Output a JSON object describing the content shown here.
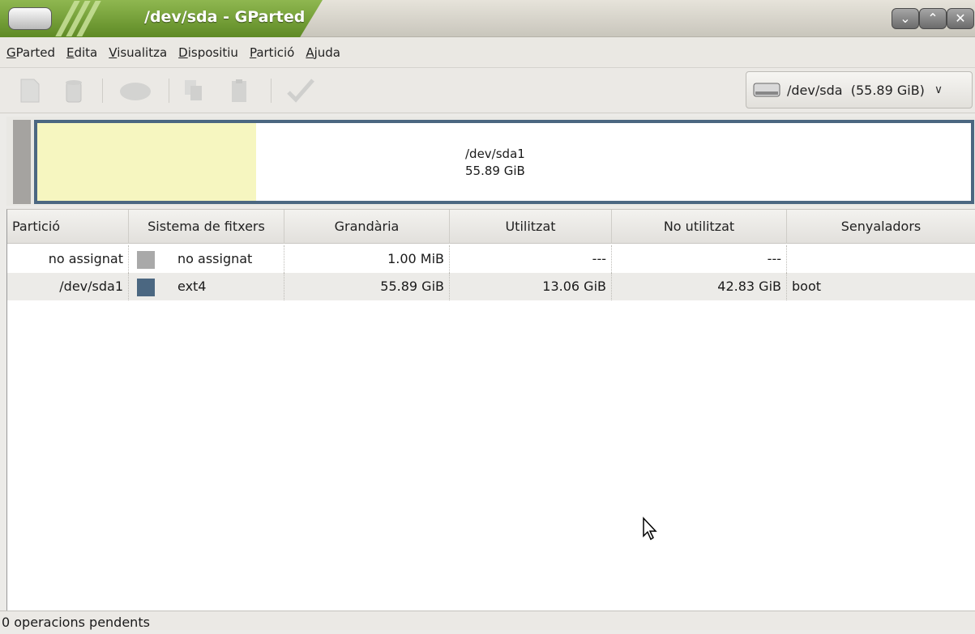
{
  "window": {
    "title": "/dev/sda - GParted"
  },
  "menu": {
    "items": [
      {
        "label": "GParted"
      },
      {
        "label": "Edita"
      },
      {
        "label": "Visualitza"
      },
      {
        "label": "Dispositiu"
      },
      {
        "label": "Partició"
      },
      {
        "label": "Ajuda"
      }
    ]
  },
  "toolbar": {
    "icons": [
      "new-partition-icon",
      "delete-icon",
      "resize-move-icon",
      "copy-icon",
      "paste-icon",
      "apply-icon"
    ],
    "device_label": "/dev/sda  (55.89 GiB)"
  },
  "disk_map": {
    "partition_name": "/dev/sda1",
    "partition_size": "55.89 GiB",
    "used_fraction": 0.234,
    "used_color": "#f6f6c0",
    "frame_color": "#4b6781"
  },
  "table": {
    "columns": [
      "Partició",
      "Sistema de fitxers",
      "Grandària",
      "Utilitzat",
      "No utilitzat",
      "Senyaladors"
    ],
    "rows": [
      {
        "partition": "no assignat",
        "fs_color": "#a9a9a9",
        "fs": "no assignat",
        "size": "1.00 MiB",
        "used": "---",
        "unused": "---",
        "flags": ""
      },
      {
        "partition": "/dev/sda1",
        "fs_color": "#4b6781",
        "fs": "ext4",
        "size": "55.89 GiB",
        "used": "13.06 GiB",
        "unused": "42.83 GiB",
        "flags": "boot"
      }
    ]
  },
  "status": {
    "text": "0 operacions pendents"
  }
}
